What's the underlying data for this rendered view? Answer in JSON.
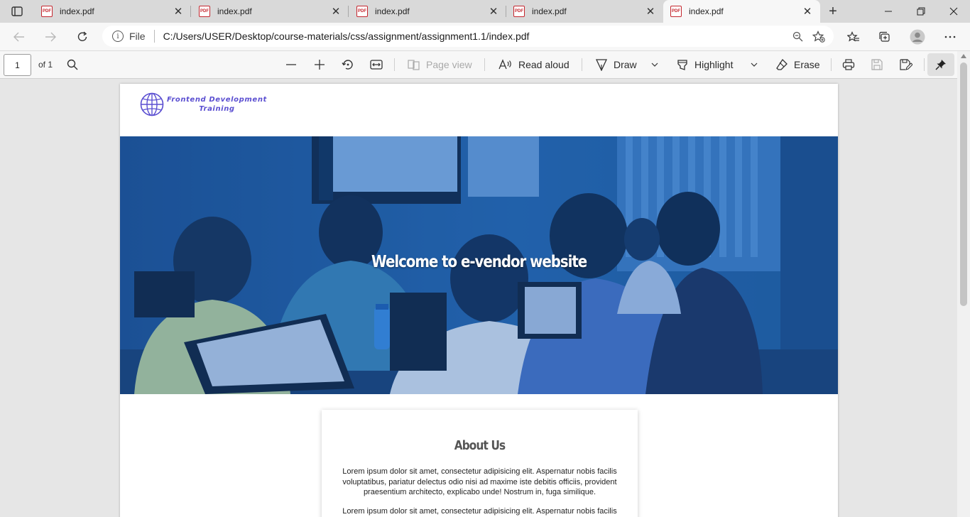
{
  "browser": {
    "tabs": [
      {
        "title": "index.pdf",
        "active": false
      },
      {
        "title": "index.pdf",
        "active": false
      },
      {
        "title": "index.pdf",
        "active": false
      },
      {
        "title": "index.pdf",
        "active": false
      },
      {
        "title": "index.pdf",
        "active": true
      }
    ],
    "address": {
      "scheme": "File",
      "path": "C:/Users/USER/Desktop/course-materials/css/assignment/assignment1.1/index.pdf"
    }
  },
  "pdf_toolbar": {
    "page_number": "1",
    "page_total": "of 1",
    "page_view": "Page view",
    "read_aloud": "Read aloud",
    "draw": "Draw",
    "highlight": "Highlight",
    "erase": "Erase"
  },
  "document": {
    "logo": {
      "line1": "Frontend Development",
      "line2": "Training",
      "color": "#5b4fd1"
    },
    "hero_title": "Welcome to e-vendor website",
    "about": {
      "title": "About Us",
      "paragraph1": "Lorem ipsum dolor sit amet, consectetur adipisicing elit. Aspernatur nobis facilis voluptatibus, pariatur delectus odio nisi ad maxime iste debitis officiis, provident praesentium architecto, explicabo unde! Nostrum in, fuga similique.",
      "paragraph2": "Lorem ipsum dolor sit amet, consectetur adipisicing elit. Aspernatur nobis facilis"
    }
  }
}
